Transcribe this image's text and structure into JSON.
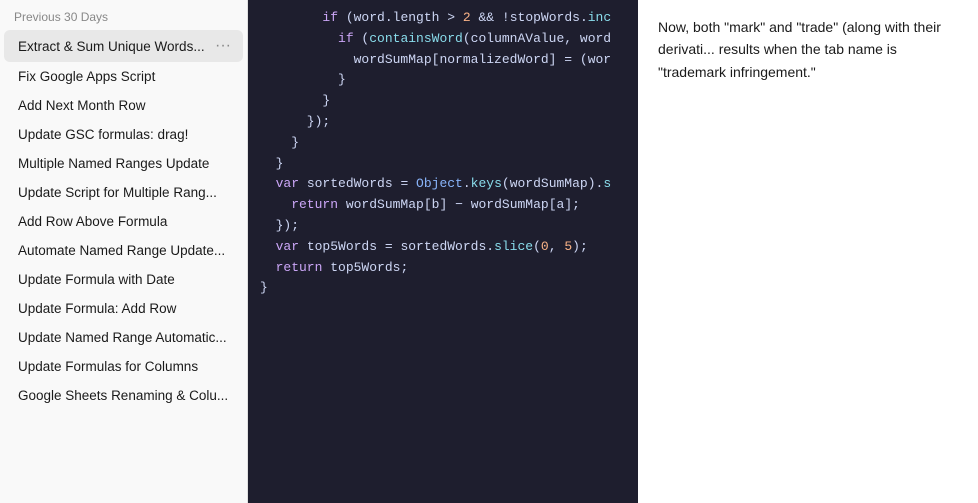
{
  "sidebar": {
    "section_label": "Previous 30 Days",
    "items": [
      {
        "id": "extract-sum",
        "label": "Extract & Sum Unique Words...",
        "active": true,
        "show_dots": true
      },
      {
        "id": "fix-google",
        "label": "Fix Google Apps Script",
        "active": false
      },
      {
        "id": "add-next-month",
        "label": "Add Next Month Row",
        "active": false
      },
      {
        "id": "update-gsc",
        "label": "Update GSC formulas: drag!",
        "active": false
      },
      {
        "id": "multiple-named",
        "label": "Multiple Named Ranges Update",
        "active": false
      },
      {
        "id": "update-script",
        "label": "Update Script for Multiple Rang...",
        "active": false
      },
      {
        "id": "add-row-above",
        "label": "Add Row Above Formula",
        "active": false
      },
      {
        "id": "automate-named",
        "label": "Automate Named Range Update...",
        "active": false
      },
      {
        "id": "update-formula-date",
        "label": "Update Formula with Date",
        "active": false
      },
      {
        "id": "update-formula-add",
        "label": "Update Formula: Add Row",
        "active": false
      },
      {
        "id": "update-named-auto",
        "label": "Update Named Range Automatic...",
        "active": false
      },
      {
        "id": "update-formulas-col",
        "label": "Update Formulas for Columns",
        "active": false
      },
      {
        "id": "google-sheets-rename",
        "label": "Google Sheets Renaming & Colu...",
        "active": false
      }
    ]
  },
  "code": {
    "lines": [
      "        if (word.length > 2 && !stopWords.inc",
      "          if (containsWord(columnAValue, word",
      "            wordSumMap[normalizedWord] = (wor",
      "          }",
      "        }",
      "      });",
      "    }",
      "  }",
      "",
      "  var sortedWords = Object.keys(wordSumMap).s",
      "    return wordSumMap[b] - wordSumMap[a];",
      "  });",
      "",
      "  var top5Words = sortedWords.slice(0, 5);",
      "",
      "  return top5Words;",
      "}"
    ]
  },
  "text_content": {
    "paragraph": "Now, both \"mark\" and \"trade\" (along with their derivati... results when the tab name is \"trademark infringement.\""
  }
}
